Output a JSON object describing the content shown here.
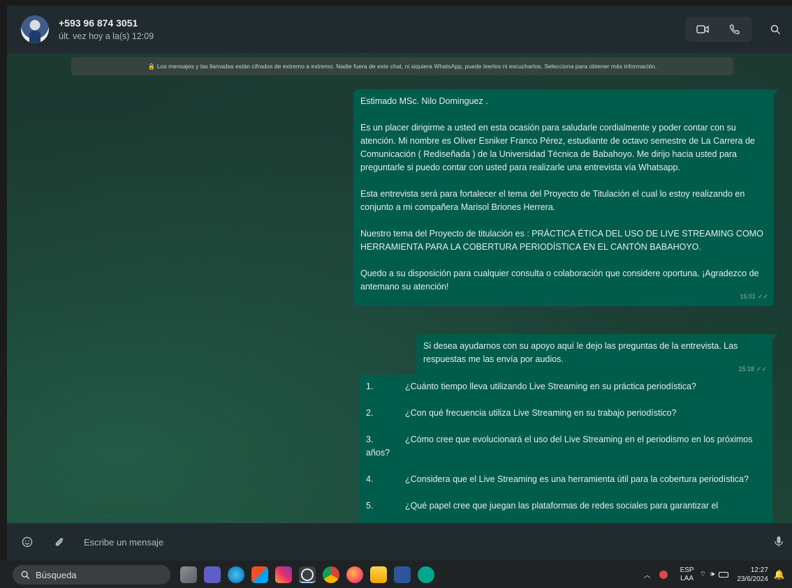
{
  "header": {
    "contact_name": "+593 96 874 3051",
    "contact_status": "últ. vez hoy a la(s) 12:09",
    "icons": [
      "video-call-icon",
      "voice-call-icon",
      "search-icon"
    ]
  },
  "encryption_notice": "🔒 Los mensajes y las llamadas están cifrados de extremo a extremo. Nadie fuera de este chat, ni siquiera WhatsApp, puede leerlos ni escucharlos. Selecciona para obtener más información.",
  "messages": [
    {
      "paragraphs": [
        "Estimado MSc. Nilo Dominguez .",
        "Es un placer dirigirme a usted en esta ocasión para saludarle cordialmente y poder contar con su atención. Mi nombre es Oliver Esniker Franco Pérez, estudiante de octavo semestre de La Carrera de Comunicación ( Rediseñada ) de la Universidad Técnica de Babahoyo. Me dirijo hacia usted para preguntarle si puedo contar con usted para realizarle una entrevista vía Whatsapp.",
        "Esta entrevista será para fortalecer el tema del Proyecto de Titulación el cual lo estoy realizando en conjunto a mi compañera Marisol Briones Herrera.",
        "Nuestro tema del Proyecto de titulación es : PRÁCTICA ÉTICA DEL USO DE LIVE STREAMING COMO HERRAMIENTA PARA LA COBERTURA PERIODÍSTICA EN EL CANTÓN BABAHOYO.",
        "Quedo a su disposición para cualquier consulta o colaboración que considere oportuna. ¡Agradezco de antemano su atención!"
      ],
      "time": "15:01"
    },
    {
      "paragraphs": [
        "Si desea ayudarnos con su apoyo aquí le dejo las preguntas de la entrevista. Las respuestas me las envía por audios."
      ],
      "time": "15:18"
    },
    {
      "questions": [
        {
          "num": "1.",
          "text": "¿Cuánto tiempo lleva utilizando Live Streaming en su práctica periodística?"
        },
        {
          "num": "2.",
          "text": "¿Con qué frecuencia utiliza Live Streaming en su trabajo periodístico?"
        },
        {
          "num": "3.",
          "text": "¿Cómo cree que evolucionará el uso del Live Streaming en el periodismo en los próximos años?"
        },
        {
          "num": "4.",
          "text": "¿Considera que el Live Streaming es una herramienta útil para la cobertura periodística?"
        },
        {
          "num": "5.",
          "text": "¿Qué papel cree que juegan las plataformas de redes sociales para garantizar el"
        }
      ]
    }
  ],
  "composer": {
    "placeholder": "Escribe un mensaje"
  },
  "taskbar": {
    "search_label": "Búsqueda",
    "lang_line1": "ESP",
    "lang_line2": "LAA",
    "time": "12:27",
    "date": "23/6/2024"
  },
  "colors": {
    "outgoing_bubble": "#005c4b",
    "header_bg": "#202a2f"
  }
}
